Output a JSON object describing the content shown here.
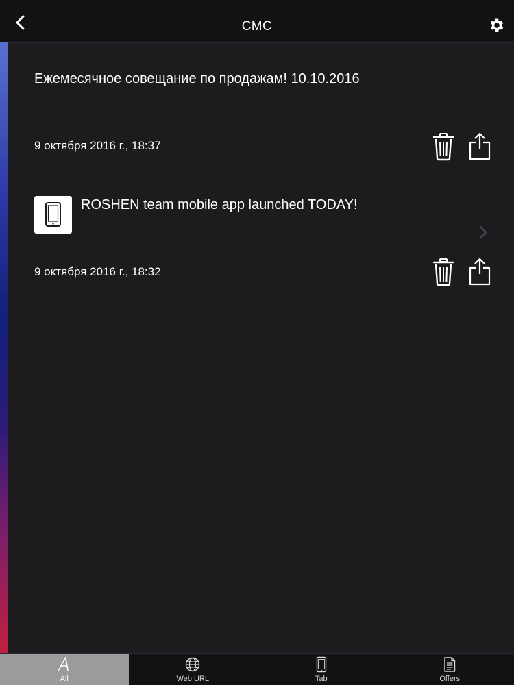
{
  "navbar": {
    "title": "СМС",
    "back_icon": "chevron-left-icon",
    "settings_icon": "gear-icon"
  },
  "messages": [
    {
      "text": "Ежемесячное совещание по продажам! 10.10.2016",
      "date": "9 октября 2016 г., 18:37",
      "has_thumbnail": false
    },
    {
      "text": "ROSHEN team mobile app launched  TODAY!",
      "date": "9 октября 2016 г., 18:32",
      "has_thumbnail": true,
      "thumbnail_icon": "tablet-icon"
    }
  ],
  "tabs": [
    {
      "label": "All",
      "icon": "letter-a-icon",
      "active": true
    },
    {
      "label": "Web URL",
      "icon": "globe-icon",
      "active": false
    },
    {
      "label": "Tab",
      "icon": "tablet-icon",
      "active": false
    },
    {
      "label": "Offers",
      "icon": "document-icon",
      "active": false
    }
  ],
  "colors": {
    "background": "#1d1b1e",
    "bar": "#121113",
    "active_tab": "#9c9a9d",
    "text": "#ffffff"
  }
}
